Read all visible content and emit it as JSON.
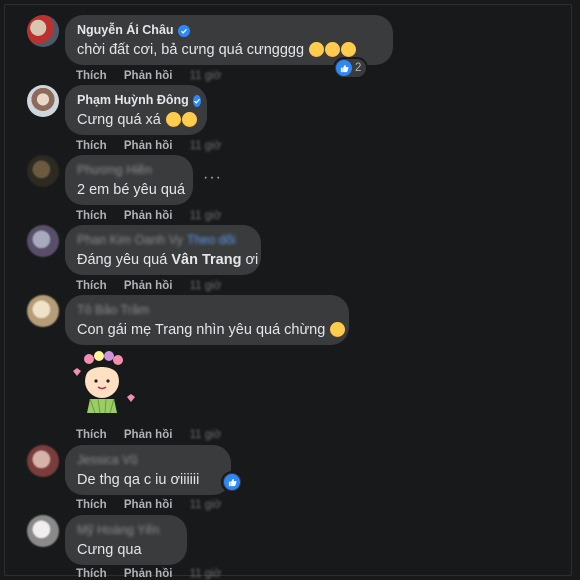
{
  "comments": [
    {
      "author": "Nguyễn Ái Châu",
      "verified": true,
      "text": "chời đất cơi, bả cưng quá cưngggg",
      "emoji_count": 3,
      "reaction_count": "2",
      "like": "Thích",
      "reply": "Phản hồi",
      "time": "11 giờ"
    },
    {
      "author": "Phạm Huỳnh Đông",
      "verified": true,
      "text": "Cưng quá xá",
      "emoji_count": 2,
      "like": "Thích",
      "reply": "Phản hồi",
      "time": "11 giờ"
    },
    {
      "author": "Phương Hiền",
      "verified": false,
      "text": "2 em bé yêu quá",
      "more": "···",
      "like": "Thích",
      "reply": "Phản hồi",
      "time": "11 giờ"
    },
    {
      "author": "Phan Kim Oanh Vy",
      "verified": false,
      "tag_label": "Theo dõi",
      "text_prefix": "Đáng yêu quá ",
      "mention": "Vân Trang",
      "text_suffix": " ơi",
      "like": "Thích",
      "reply": "Phản hồi",
      "time": "11 giờ"
    },
    {
      "author": "Tô Bảo Trâm",
      "verified": false,
      "text": "Con gái mẹ Trang nhìn yêu quá chừng",
      "sticker": "girl-with-flower-crown-sticker",
      "like": "Thích",
      "reply": "Phản hồi",
      "time": "11 giờ"
    },
    {
      "author": "Jessica Vũ",
      "verified": false,
      "text": "De thg qa c iu ơiiiiii",
      "like": "Thích",
      "reply": "Phản hồi",
      "time": "11 giờ"
    },
    {
      "author": "Mỹ Hoàng Yến",
      "verified": false,
      "text": "Cưng qua",
      "like": "Thích",
      "reply": "Phản hồi",
      "time": "11 giờ"
    }
  ],
  "colors": {
    "background": "#18191a",
    "bubble": "#3a3b3c",
    "text": "#e4e6eb",
    "secondary": "#b0b3b8",
    "verified": "#2d88ff"
  }
}
